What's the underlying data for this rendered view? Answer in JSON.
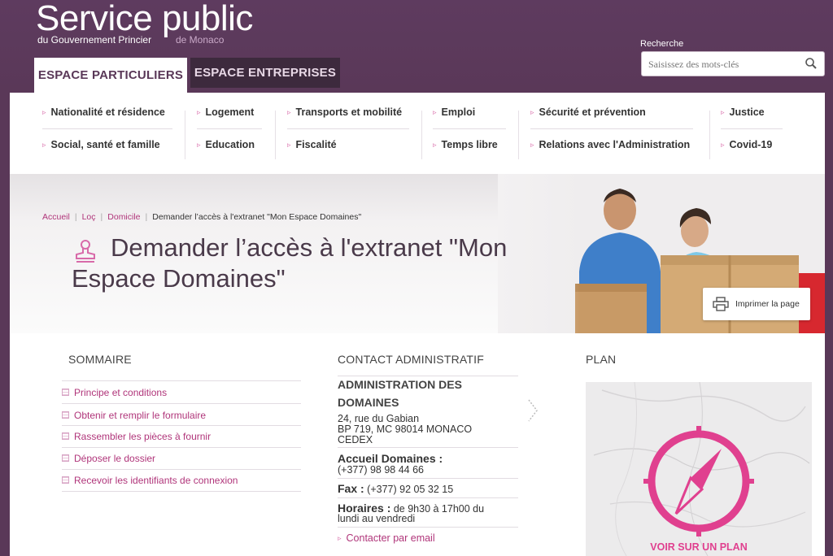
{
  "header": {
    "logo_main": "Service public",
    "logo_sub": "du Gouvernement Princier",
    "logo_sub2": "de Monaco",
    "tabs": [
      {
        "label": "ESPACE PARTICULIERS",
        "active": true
      },
      {
        "label": "ESPACE ENTREPRISES",
        "active": false
      }
    ],
    "search": {
      "label": "Recherche",
      "placeholder": "Saisissez des mots-clés"
    }
  },
  "nav": {
    "row1": [
      "Nationalité et résidence",
      "Logement",
      "Transports et mobilité",
      "Emploi",
      "Sécurité et prévention",
      "Justice"
    ],
    "row2": [
      "Social, santé et famille",
      "Education",
      "Fiscalité",
      "Temps libre",
      "Relations avec l'Administration",
      "Covid-19"
    ]
  },
  "breadcrumb": {
    "items": [
      "Accueil",
      "Loç",
      "Domicile"
    ],
    "current": "Demander l’accès à l'extranet \"Mon Espace Domaines\""
  },
  "page": {
    "title_line1": "Demander l’accès à l'extranet \"Mon",
    "title_line2": "Espace Domaines\"",
    "print_label": "Imprimer la page"
  },
  "sommaire": {
    "title": "SOMMAIRE",
    "items": [
      "Principe et conditions",
      "Obtenir et remplir le formulaire",
      "Rassembler les pièces à fournir",
      "Déposer le dossier",
      "Recevoir les identifiants de connexion"
    ]
  },
  "contact": {
    "title": "CONTACT ADMINISTRATIF",
    "org_line1": "ADMINISTRATION DES",
    "org_line2": "DOMAINES",
    "address_line1": "24, rue du Gabian",
    "address_line2": "BP 719, MC 98014 MONACO",
    "address_line3": "CEDEX",
    "accueil_label": "Accueil Domaines :",
    "accueil_phone": "(+377) 98 98 44 66",
    "fax_label": "Fax :",
    "fax_value": "(+377) 92 05 32 15",
    "horaires_label": "Horaires :",
    "horaires_value1": "de 9h30 à 17h00 du",
    "horaires_value2": "lundi au vendredi",
    "email_link": "Contacter par email"
  },
  "plan": {
    "title": "PLAN",
    "caption": "VOIR SUR UN PLAN"
  },
  "colors": {
    "brand_purple": "#5a3858",
    "accent_pink": "#b0357a",
    "map_pink": "#e0408f"
  }
}
